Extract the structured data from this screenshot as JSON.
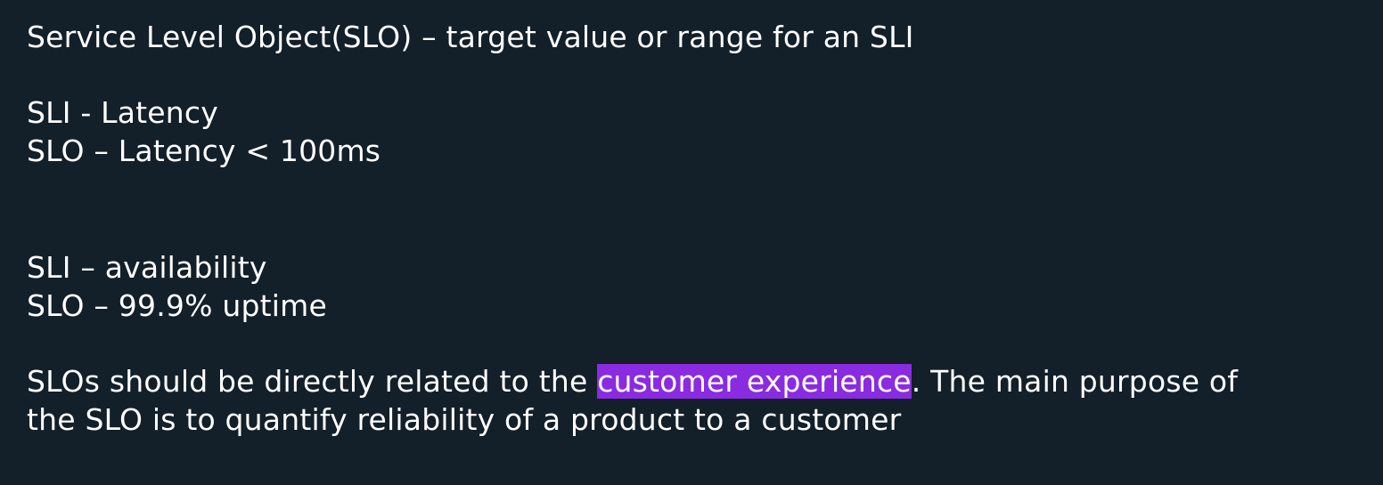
{
  "lines": {
    "slo_definition": "Service Level Object(SLO) – target value or range for an SLI",
    "sli_latency": "SLI - Latency",
    "slo_latency": "SLO – Latency < 100ms",
    "sli_availability": "SLI – availability",
    "slo_availability": "SLO – 99.9% uptime"
  },
  "paragraph": {
    "before_highlight": "SLOs should be directly related to the ",
    "highlight": "customer experience",
    "after_highlight": ". The main purpose of",
    "second_line": "the SLO is to quantify reliability of a product to a customer"
  },
  "colors": {
    "background": "#131f29",
    "text": "#ffffff",
    "highlight": "#8a2be2"
  }
}
